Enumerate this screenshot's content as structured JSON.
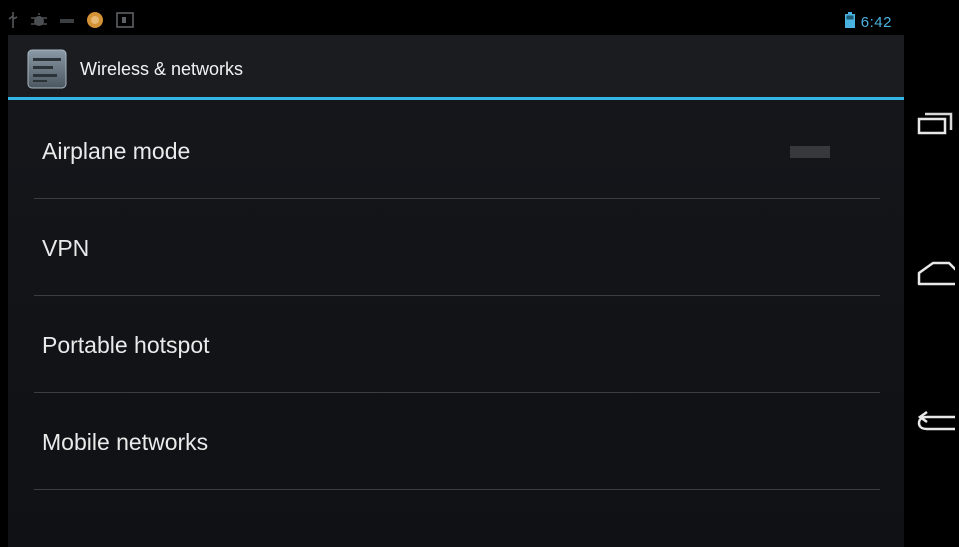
{
  "status_bar": {
    "time": "6:42",
    "icons": [
      "usb-icon",
      "debug-icon",
      "signal-icon",
      "notification-icon",
      "calendar-icon"
    ],
    "battery_icon": "battery-icon"
  },
  "action_bar": {
    "title": "Wireless & networks",
    "app_icon": "settings-app-icon",
    "accent_color": "#33b5e5"
  },
  "list": {
    "items": [
      {
        "label": "Airplane mode"
      },
      {
        "label": "VPN"
      },
      {
        "label": "Portable hotspot"
      },
      {
        "label": "Mobile networks"
      }
    ]
  },
  "nav_bar": {
    "buttons": [
      "recent-apps-icon",
      "home-icon",
      "back-icon"
    ]
  }
}
